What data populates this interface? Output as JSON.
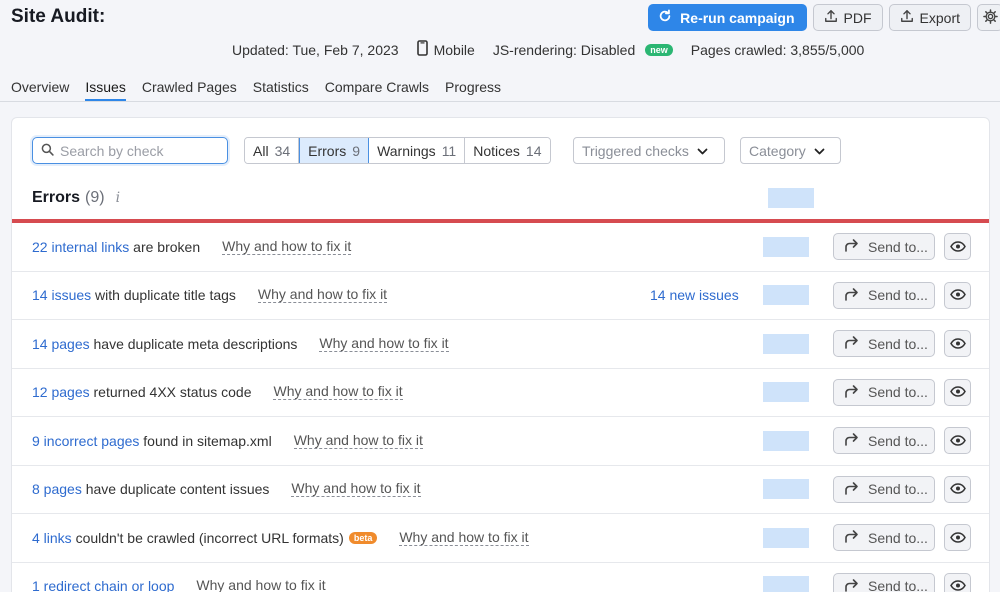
{
  "header": {
    "title": "Site Audit:",
    "rerun_label": "Re-run campaign",
    "pdf_label": "PDF",
    "export_label": "Export"
  },
  "meta": {
    "updated": "Updated: Tue, Feb 7, 2023",
    "device": "Mobile",
    "js_rendering": "JS-rendering: Disabled",
    "new_badge": "new",
    "pages_crawled": "Pages crawled: 3,855/5,000"
  },
  "tabs": [
    "Overview",
    "Issues",
    "Crawled Pages",
    "Statistics",
    "Compare Crawls",
    "Progress"
  ],
  "filters": {
    "search_placeholder": "Search by check",
    "segments": [
      {
        "label": "All",
        "count": "34"
      },
      {
        "label": "Errors",
        "count": "9"
      },
      {
        "label": "Warnings",
        "count": "11"
      },
      {
        "label": "Notices",
        "count": "14"
      }
    ],
    "triggered_checks": "Triggered checks",
    "category": "Category"
  },
  "errors_section": {
    "title": "Errors",
    "count": "(9)",
    "info": "i"
  },
  "issues": [
    {
      "link": "22 internal links",
      "text": " are broken",
      "fix": "Why and how to fix it",
      "new_issues": "",
      "beta": ""
    },
    {
      "link": "14 issues",
      "text": " with duplicate title tags",
      "fix": "Why and how to fix it",
      "new_issues": "14 new issues",
      "beta": ""
    },
    {
      "link": "14 pages",
      "text": " have duplicate meta descriptions",
      "fix": "Why and how to fix it",
      "new_issues": "",
      "beta": ""
    },
    {
      "link": "12 pages",
      "text": " returned 4XX status code",
      "fix": "Why and how to fix it",
      "new_issues": "",
      "beta": ""
    },
    {
      "link": "9 incorrect pages",
      "text": " found in sitemap.xml",
      "fix": "Why and how to fix it",
      "new_issues": "",
      "beta": ""
    },
    {
      "link": "8 pages",
      "text": " have duplicate content issues",
      "fix": "Why and how to fix it",
      "new_issues": "",
      "beta": ""
    },
    {
      "link": "4 links",
      "text": " couldn't be crawled (incorrect URL formats)",
      "fix": "Why and how to fix it",
      "new_issues": "",
      "beta": "beta"
    },
    {
      "link": "1 redirect chain or loop",
      "text": "",
      "fix": "Why and how to fix it",
      "new_issues": "",
      "beta": ""
    }
  ],
  "send_label": "Send to...",
  "colors": {
    "accent": "#2e86e8",
    "link": "#2e6bcf",
    "error_line": "#d64b50",
    "new_badge": "#2bb673",
    "beta_badge": "#f08b2c"
  }
}
